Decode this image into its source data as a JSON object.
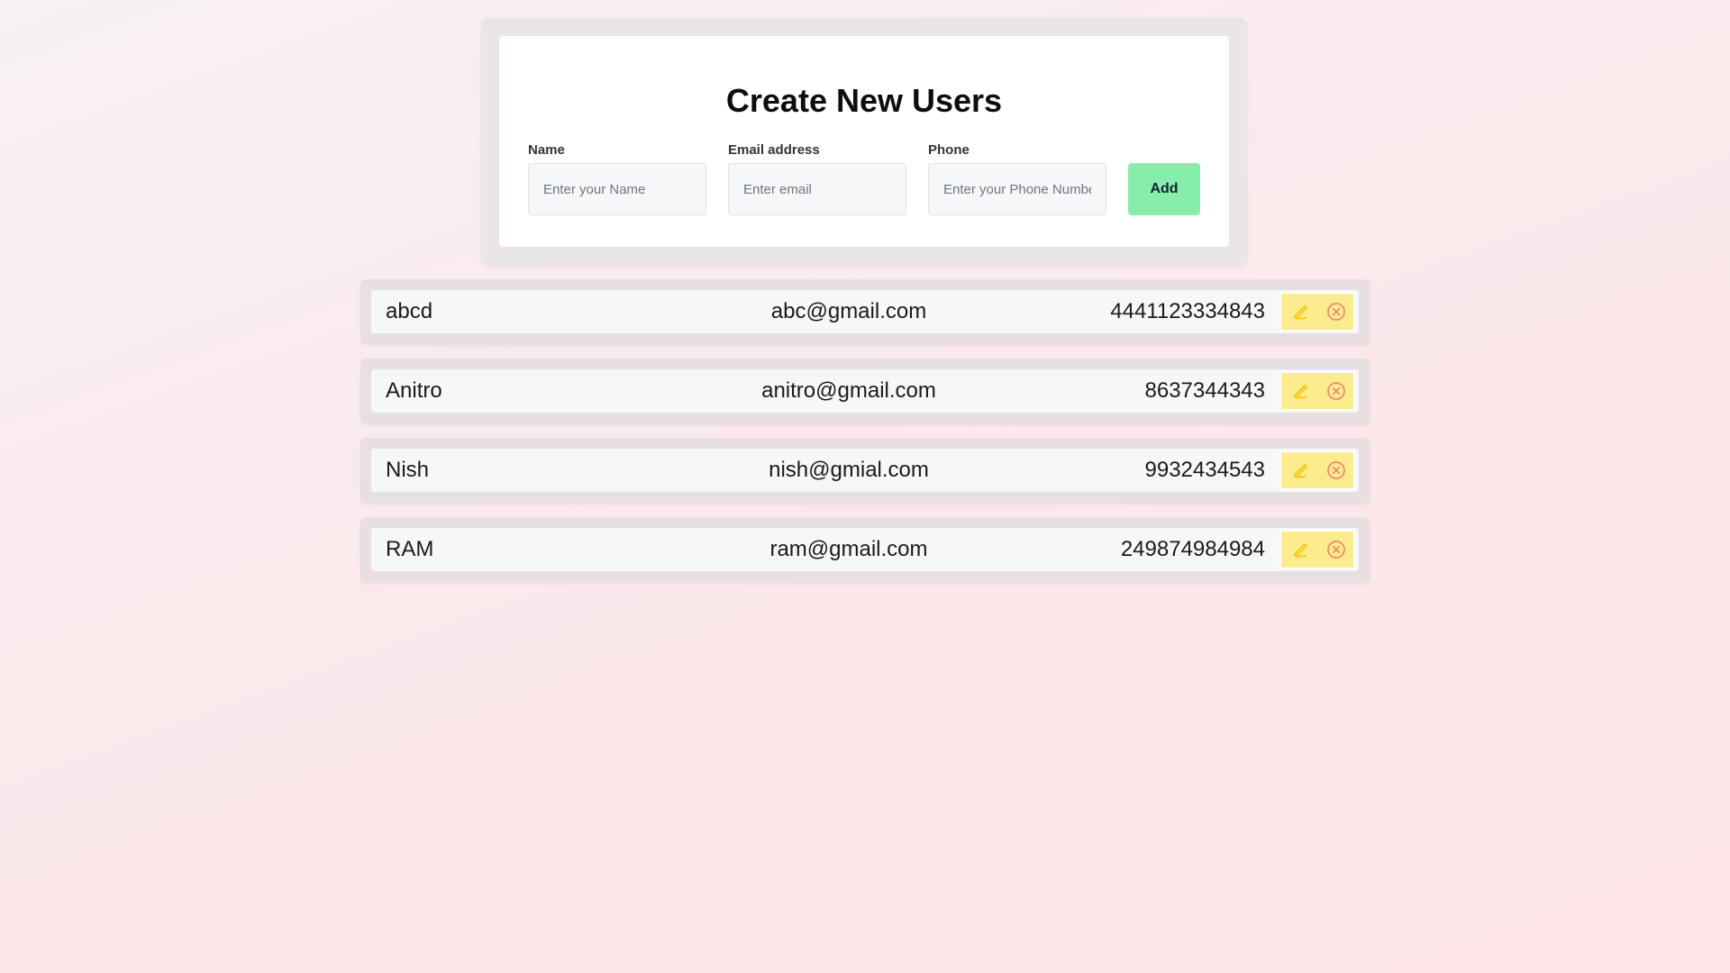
{
  "form": {
    "title": "Create New Users",
    "name_label": "Name",
    "name_placeholder": "Enter your Name",
    "name_value": "",
    "email_label": "Email address",
    "email_placeholder": "Enter email",
    "email_value": "",
    "phone_label": "Phone",
    "phone_placeholder": "Enter your Phone Number",
    "phone_value": "",
    "add_label": "Add"
  },
  "users": [
    {
      "name": "abcd",
      "email": "abc@gmail.com",
      "phone": "4441123334843"
    },
    {
      "name": "Anitro",
      "email": "anitro@gmail.com",
      "phone": "8637344343"
    },
    {
      "name": "Nish",
      "email": "nish@gmial.com",
      "phone": "9932434543"
    },
    {
      "name": "RAM",
      "email": "ram@gmail.com",
      "phone": "249874984984"
    }
  ],
  "icons": {
    "edit": "edit-icon",
    "delete": "delete-icon"
  },
  "colors": {
    "add_button": "#86eeaa",
    "action_bg": "#fdec8d",
    "edit_icon": "#f2c500",
    "delete_icon": "#f08a70"
  }
}
